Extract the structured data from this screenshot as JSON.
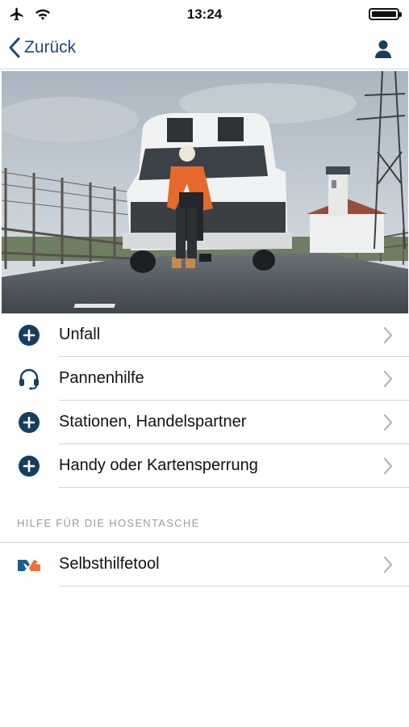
{
  "status_bar": {
    "time": "13:24",
    "icons": [
      "airplane-icon",
      "wifi-icon",
      "battery-icon"
    ]
  },
  "nav": {
    "back_label": "Zurück",
    "back_icon": "chevron-left-icon",
    "profile_icon": "person-icon"
  },
  "hero": {
    "icon": "photo-camper-van-woman-on-phone"
  },
  "menu": {
    "items": [
      {
        "label": "Unfall",
        "icon": "plus-circle-icon"
      },
      {
        "label": "Pannenhilfe",
        "icon": "headset-icon"
      },
      {
        "label": "Stationen, Handelspartner",
        "icon": "plus-circle-icon"
      },
      {
        "label": "Handy oder Kartensperrung",
        "icon": "plus-circle-icon"
      }
    ]
  },
  "section": {
    "header": "HILFE FÜR DIE HOSENTASCHE",
    "items": [
      {
        "label": "Selbsthilfetool",
        "icon": "self-help-tool-icon"
      }
    ]
  },
  "colors": {
    "accent": "#1b4b78",
    "icon_dark": "#173e5e",
    "separator": "#d4d4d4",
    "section_text": "#9a9a9a",
    "chevron": "#b5b5b5",
    "tool_orange": "#e8743b"
  }
}
